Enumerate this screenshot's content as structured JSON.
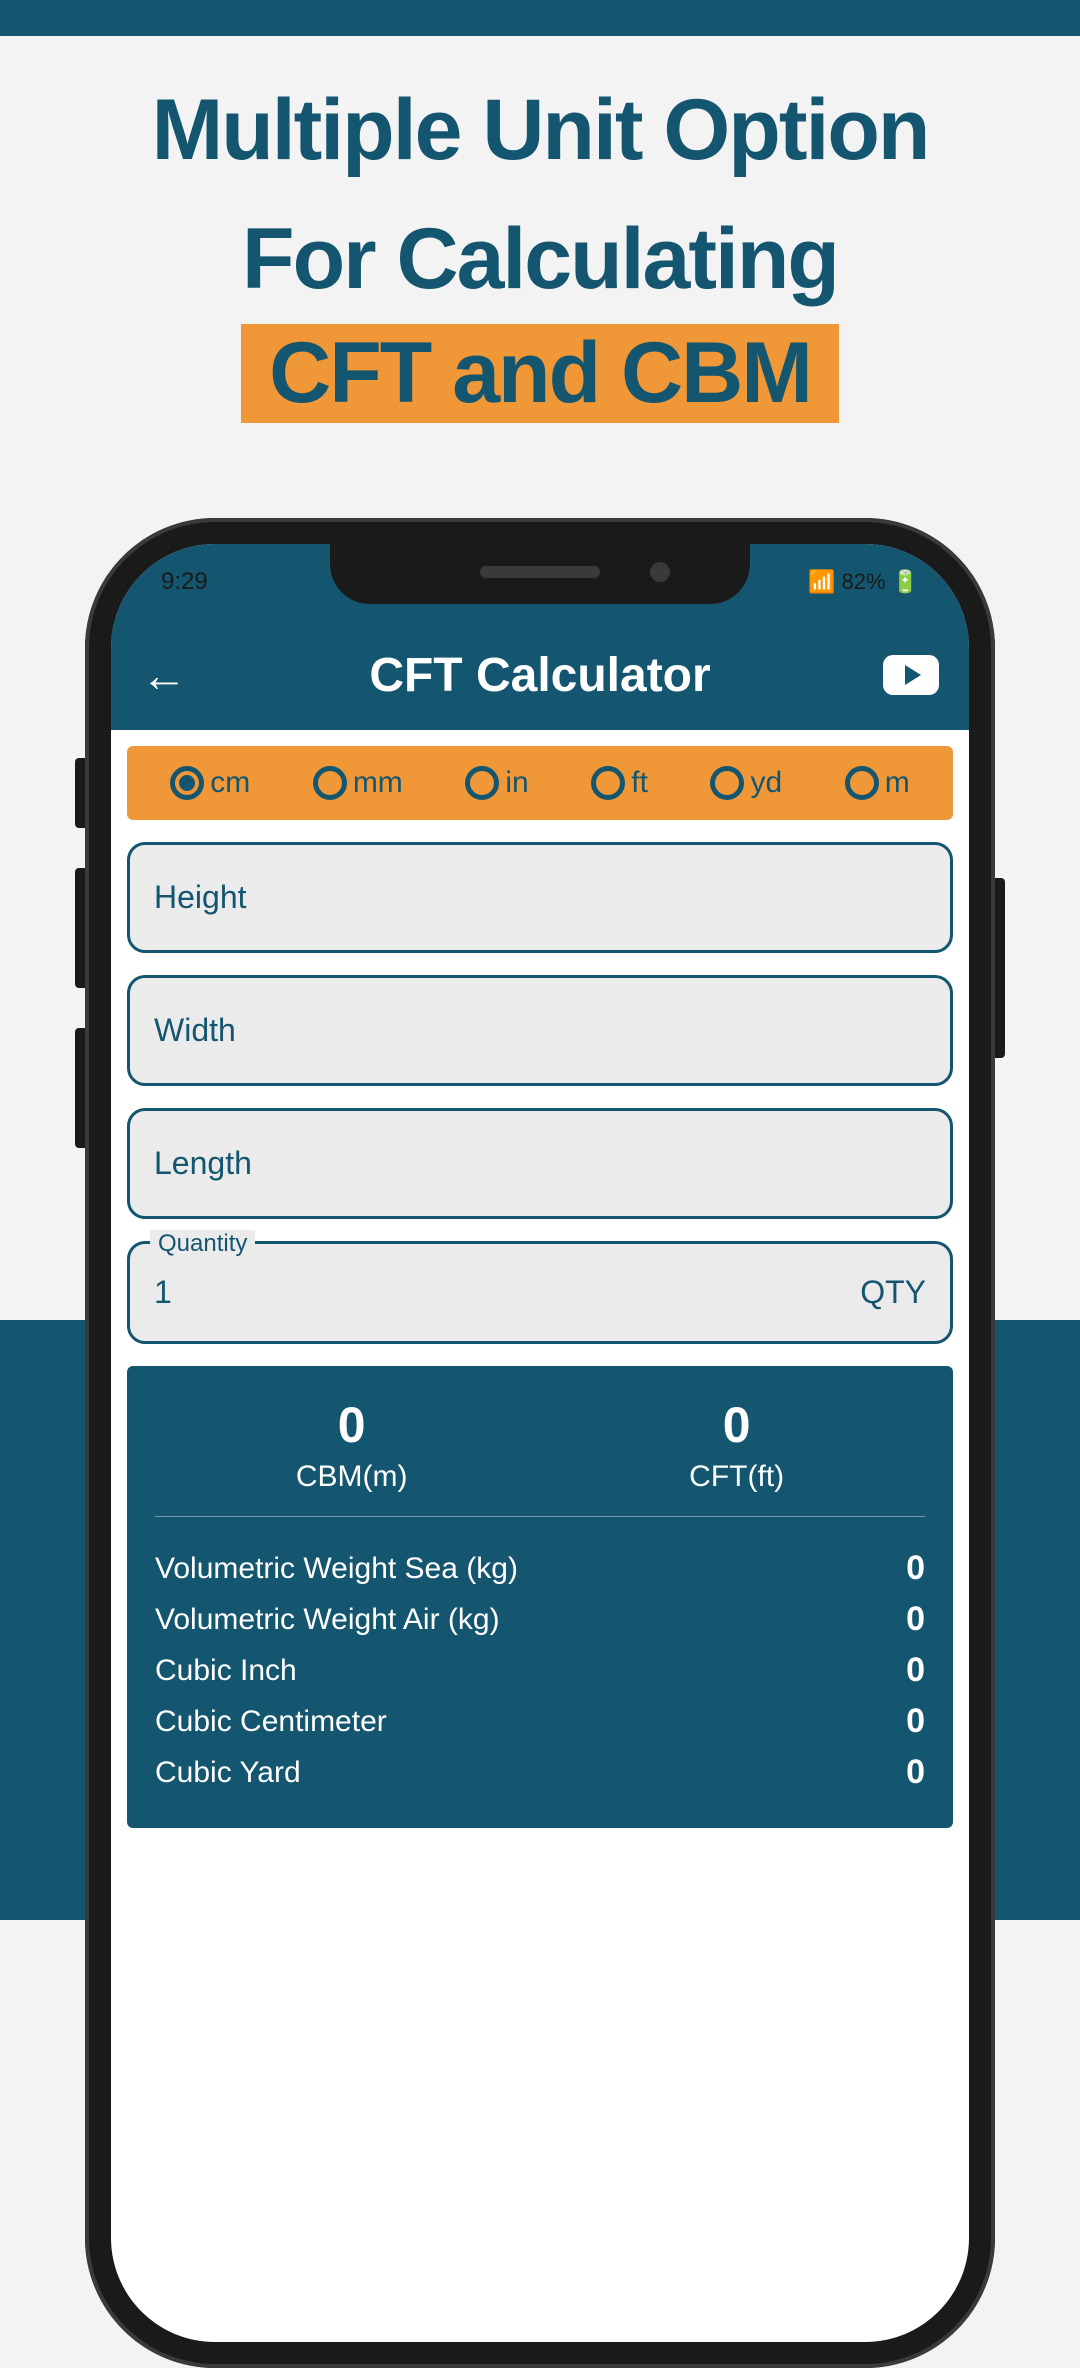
{
  "headline": {
    "line1": "Multiple Unit Option",
    "line2": "For Calculating",
    "highlight": "CFT and CBM"
  },
  "status": {
    "time": "9:29",
    "battery": "82%"
  },
  "header": {
    "title": "CFT Calculator"
  },
  "units": [
    {
      "label": "cm",
      "selected": true
    },
    {
      "label": "mm",
      "selected": false
    },
    {
      "label": "in",
      "selected": false
    },
    {
      "label": "ft",
      "selected": false
    },
    {
      "label": "yd",
      "selected": false
    },
    {
      "label": "m",
      "selected": false
    }
  ],
  "inputs": {
    "height": {
      "placeholder": "Height"
    },
    "width": {
      "placeholder": "Width"
    },
    "length": {
      "placeholder": "Length"
    },
    "quantity": {
      "label": "Quantity",
      "value": "1",
      "suffix": "QTY"
    }
  },
  "results": {
    "cbm": {
      "value": "0",
      "label": "CBM(m)"
    },
    "cft": {
      "value": "0",
      "label": "CFT(ft)"
    },
    "rows": [
      {
        "label": "Volumetric Weight Sea (kg)",
        "value": "0"
      },
      {
        "label": "Volumetric Weight Air (kg)",
        "value": "0"
      },
      {
        "label": "Cubic Inch",
        "value": "0"
      },
      {
        "label": "Cubic Centimeter",
        "value": "0"
      },
      {
        "label": "Cubic Yard",
        "value": "0"
      }
    ]
  }
}
